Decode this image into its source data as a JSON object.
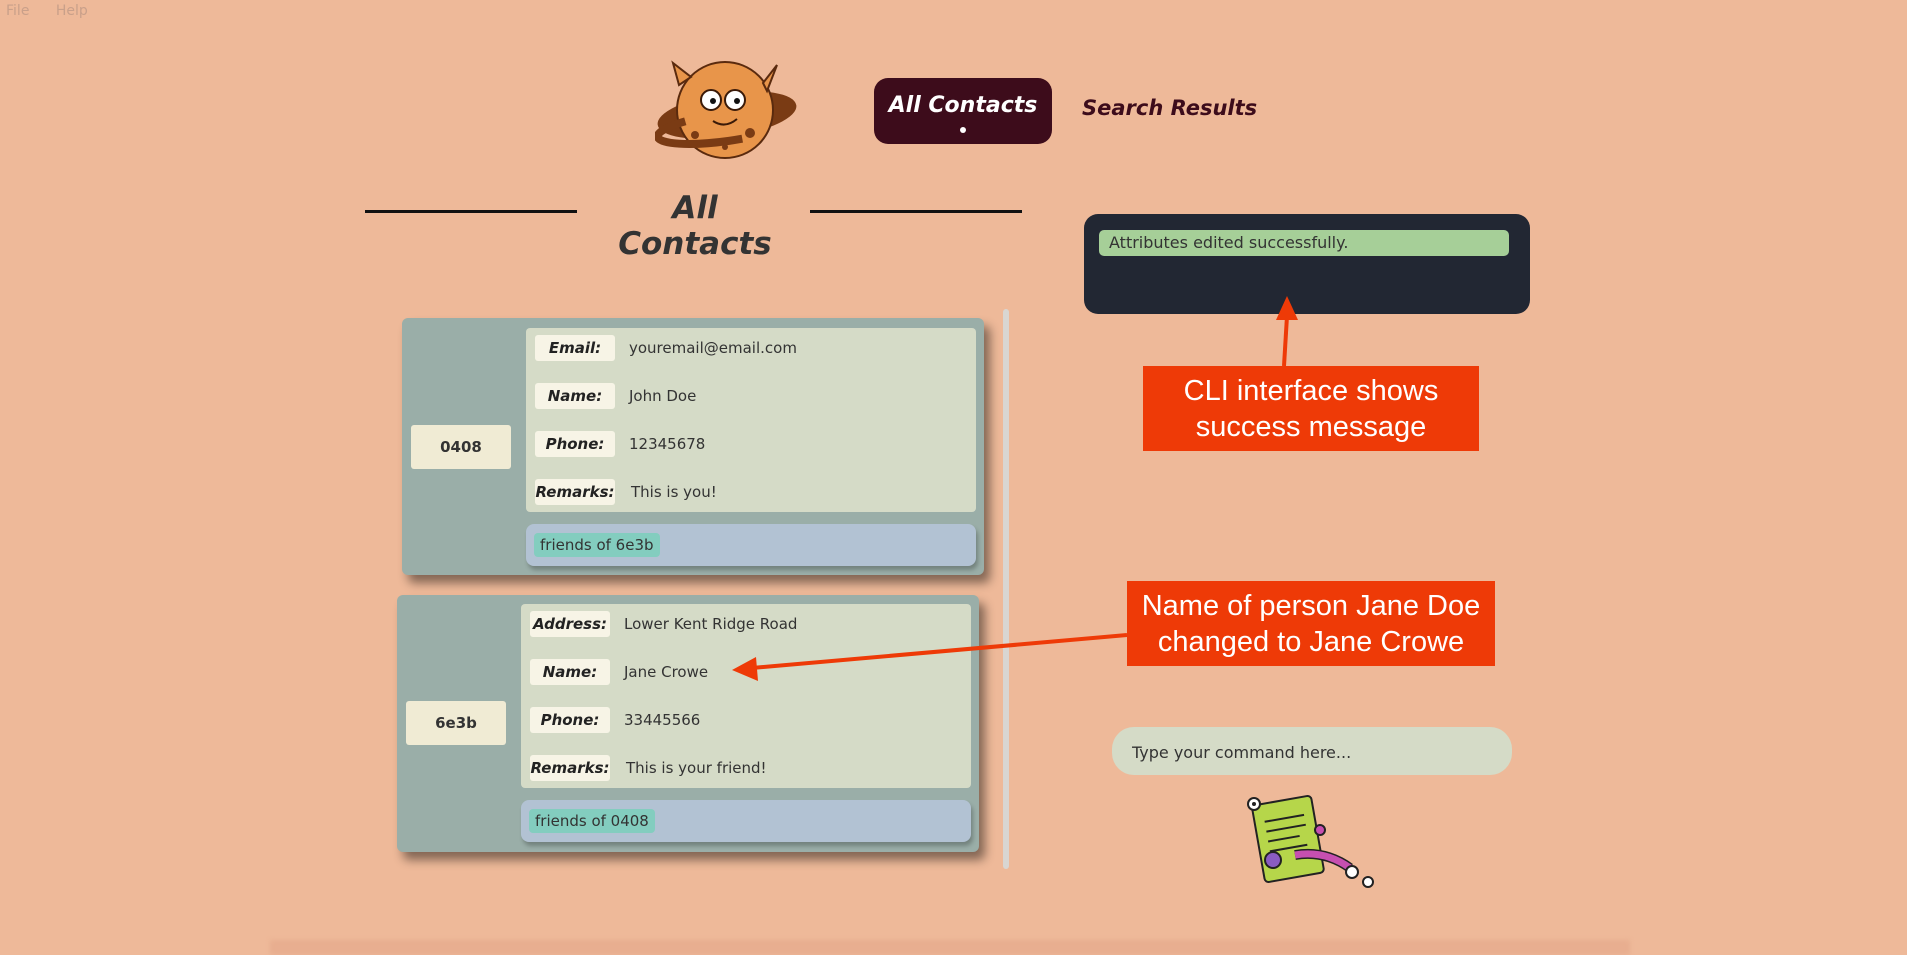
{
  "menubar": {
    "file": "File",
    "help": "Help"
  },
  "tabs": {
    "all_contacts": "All Contacts",
    "search_results": "Search Results"
  },
  "section_title": "All Contacts",
  "contacts": [
    {
      "id": "0408",
      "fields": [
        {
          "label": "Email:",
          "value": "youremail@email.com"
        },
        {
          "label": "Name:",
          "value": "John Doe"
        },
        {
          "label": "Phone:",
          "value": "12345678"
        },
        {
          "label": "Remarks:",
          "value": "This is you!"
        }
      ],
      "tag": "friends of 6e3b"
    },
    {
      "id": "6e3b",
      "fields": [
        {
          "label": "Address:",
          "value": "Lower Kent Ridge Road"
        },
        {
          "label": "Name:",
          "value": "Jane Crowe"
        },
        {
          "label": "Phone:",
          "value": "33445566"
        },
        {
          "label": "Remarks:",
          "value": "This is your friend!"
        }
      ],
      "tag": "friends of 0408"
    }
  ],
  "result_message": "Attributes edited successfully.",
  "command": {
    "placeholder": "Type your command here..."
  },
  "annotations": {
    "cli_note": "CLI interface shows success message",
    "name_note": "Name of person Jane Doe changed to Jane Crowe"
  },
  "colors": {
    "background": "#eeb999",
    "active_tab": "#3d0c1b",
    "callout": "#ee3a07",
    "result_box": "#222733",
    "success": "#a6cf98"
  }
}
